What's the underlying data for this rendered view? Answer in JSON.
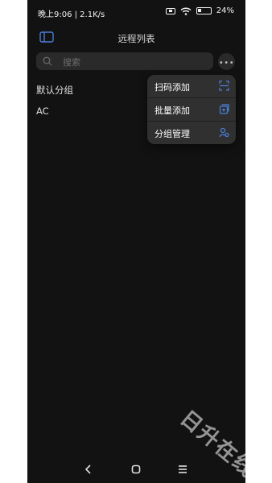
{
  "status_bar": {
    "time_speed": "晚上9:06 | 2.1K/s",
    "battery": "24%",
    "battery_level": 0.24
  },
  "header": {
    "title": "远程列表",
    "panel_icon": "sidebar-panel-icon"
  },
  "search": {
    "placeholder": "搜索",
    "icon": "search-icon"
  },
  "groups": [
    {
      "label": "默认分组"
    },
    {
      "label": "AC"
    }
  ],
  "menu": {
    "items": [
      {
        "label": "扫码添加",
        "icon": "scan-icon"
      },
      {
        "label": "批量添加",
        "icon": "batch-add-icon"
      },
      {
        "label": "分组管理",
        "icon": "group-manage-icon"
      }
    ]
  },
  "watermark": "日升在线",
  "colors": {
    "background": "#121212",
    "accent": "#4a7fd6",
    "menu_bg": "#303030"
  }
}
